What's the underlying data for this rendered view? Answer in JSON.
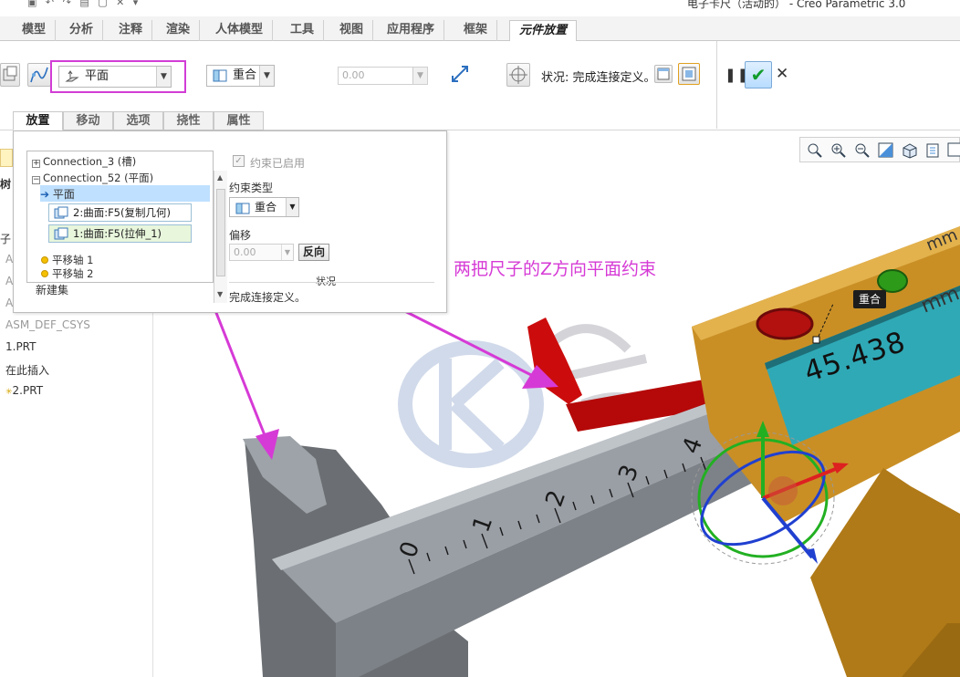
{
  "window": {
    "title": "电子卡尺（活动的） - Creo Parametric 3.0"
  },
  "ribbon_tabs": [
    "模型",
    "分析",
    "注释",
    "渲染",
    "人体模型",
    "工具",
    "视图",
    "应用程序",
    "框架",
    "元件放置"
  ],
  "ribbon": {
    "connection_type": "平面",
    "constraint_type": "重合",
    "offset_value": "0.00",
    "status_text": "状况: 完成连接定义。"
  },
  "sub_tabs": [
    "放置",
    "移动",
    "选项",
    "挠性",
    "属性"
  ],
  "model_tree": [
    {
      "label": "子",
      "dim": false
    },
    {
      "label": "A",
      "dim": true
    },
    {
      "label": "A",
      "dim": true
    },
    {
      "label": "A",
      "dim": true
    },
    {
      "label": "ASM_DEF_CSYS",
      "dim": true
    },
    {
      "label": "1.PRT",
      "dim": false
    },
    {
      "label": "在此插入",
      "dim": false
    },
    {
      "label": "2.PRT",
      "dim": false
    }
  ],
  "placement_panel": {
    "connections": [
      {
        "label": "Connection_3 (槽)",
        "expanded": false
      },
      {
        "label": "Connection_52 (平面)",
        "expanded": true
      }
    ],
    "active_constraint": "平面",
    "references": [
      "2:曲面:F5(复制几何)",
      "1:曲面:F5(拉伸_1)"
    ],
    "axes": [
      "平移轴 1",
      "平移轴 2"
    ],
    "new_set": "新建集",
    "constraint_enabled_label": "约束已启用",
    "constraint_type_label": "约束类型",
    "constraint_type_value": "重合",
    "offset_label": "偏移",
    "offset_value": "0.00",
    "flip_label": "反向",
    "status_label": "状况",
    "status_text": "完成连接定义。"
  },
  "annotation": {
    "text": "两把尺子的Z方向平面约束",
    "color": "#d63ad6"
  },
  "viewport": {
    "constraint_tag": "重合",
    "caliper_readout": "45.438",
    "scale_numbers": [
      "0",
      "1",
      "2",
      "3",
      "4"
    ],
    "unit_label": "mm"
  },
  "colors": {
    "highlight": "#d23dd6",
    "caliper_body": "#c98f25",
    "caliper_display": "#2fa9b6",
    "ruler": "#9a9fa6",
    "red_part": "#cc0c0c",
    "ok_green": "#129c2c"
  }
}
